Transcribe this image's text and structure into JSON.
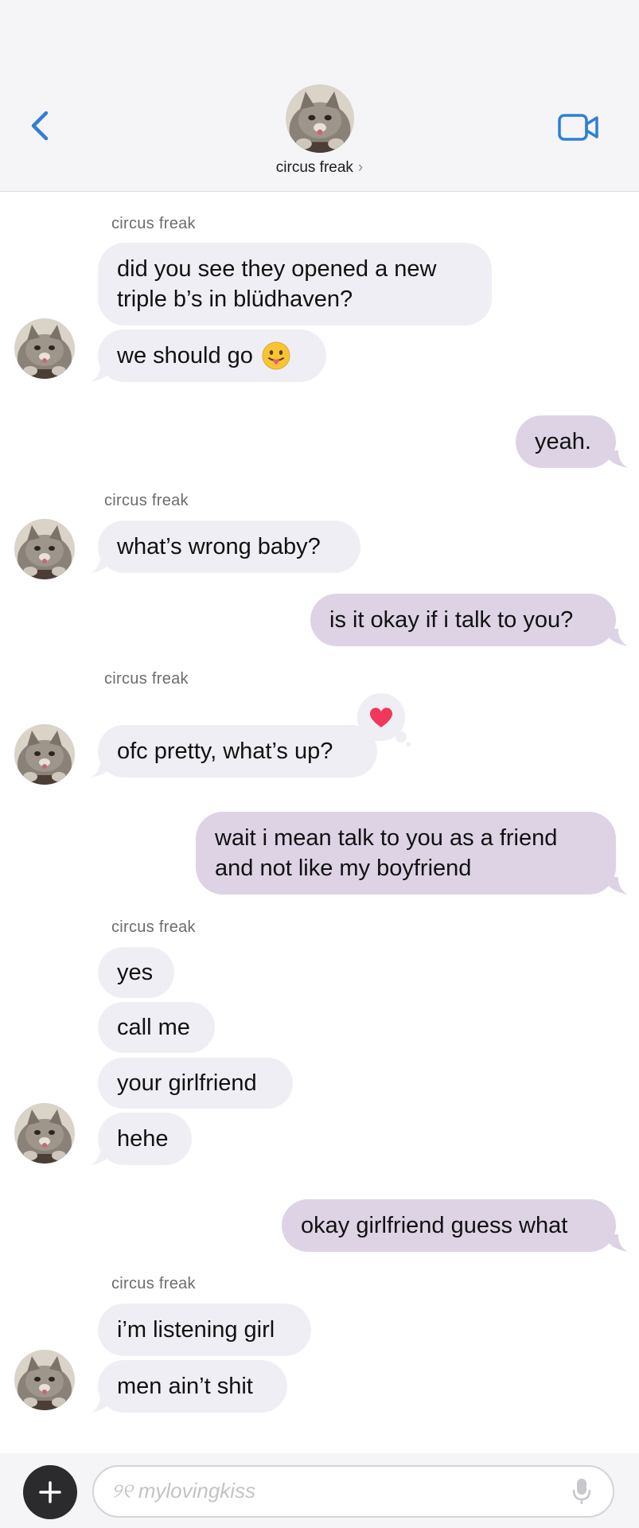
{
  "header": {
    "contact_name": "circus freak",
    "chevron": "›",
    "back_icon": "chevron-left-icon",
    "video_icon": "video-camera-icon",
    "accent": "#2f7fd4"
  },
  "messages": {
    "s1": "circus freak",
    "m1": "did you see they opened a new triple b’s in blüdhaven?",
    "m2": "we should go",
    "m3": "yeah.",
    "s2": "circus freak",
    "m4": "what’s wrong baby?",
    "m5": "is it okay if i talk to you?",
    "s3": "circus freak",
    "m6": "ofc pretty, what’s up?",
    "m7": "wait i mean talk to you as a friend and not like my boyfriend",
    "s4": "circus freak",
    "m8": "yes",
    "m9": "call me",
    "m10": "your girlfriend",
    "m11": "hehe",
    "m12": "okay girlfriend guess what",
    "s5": "circus freak",
    "m13": "i’m listening girl",
    "m14": "men ain’t shit"
  },
  "reaction": {
    "icon": "heart-icon",
    "color": "#f0385a"
  },
  "emoji": {
    "m2": "tongue-out-emoji-icon"
  },
  "composer": {
    "placeholder": "୨୧ mylovingkiss",
    "plus_icon": "plus-icon",
    "mic_icon": "microphone-icon"
  },
  "colors": {
    "incoming_bubble": "#efeef4",
    "outgoing_bubble": "#ddd3e5",
    "header_bg": "#f5f5f7"
  }
}
